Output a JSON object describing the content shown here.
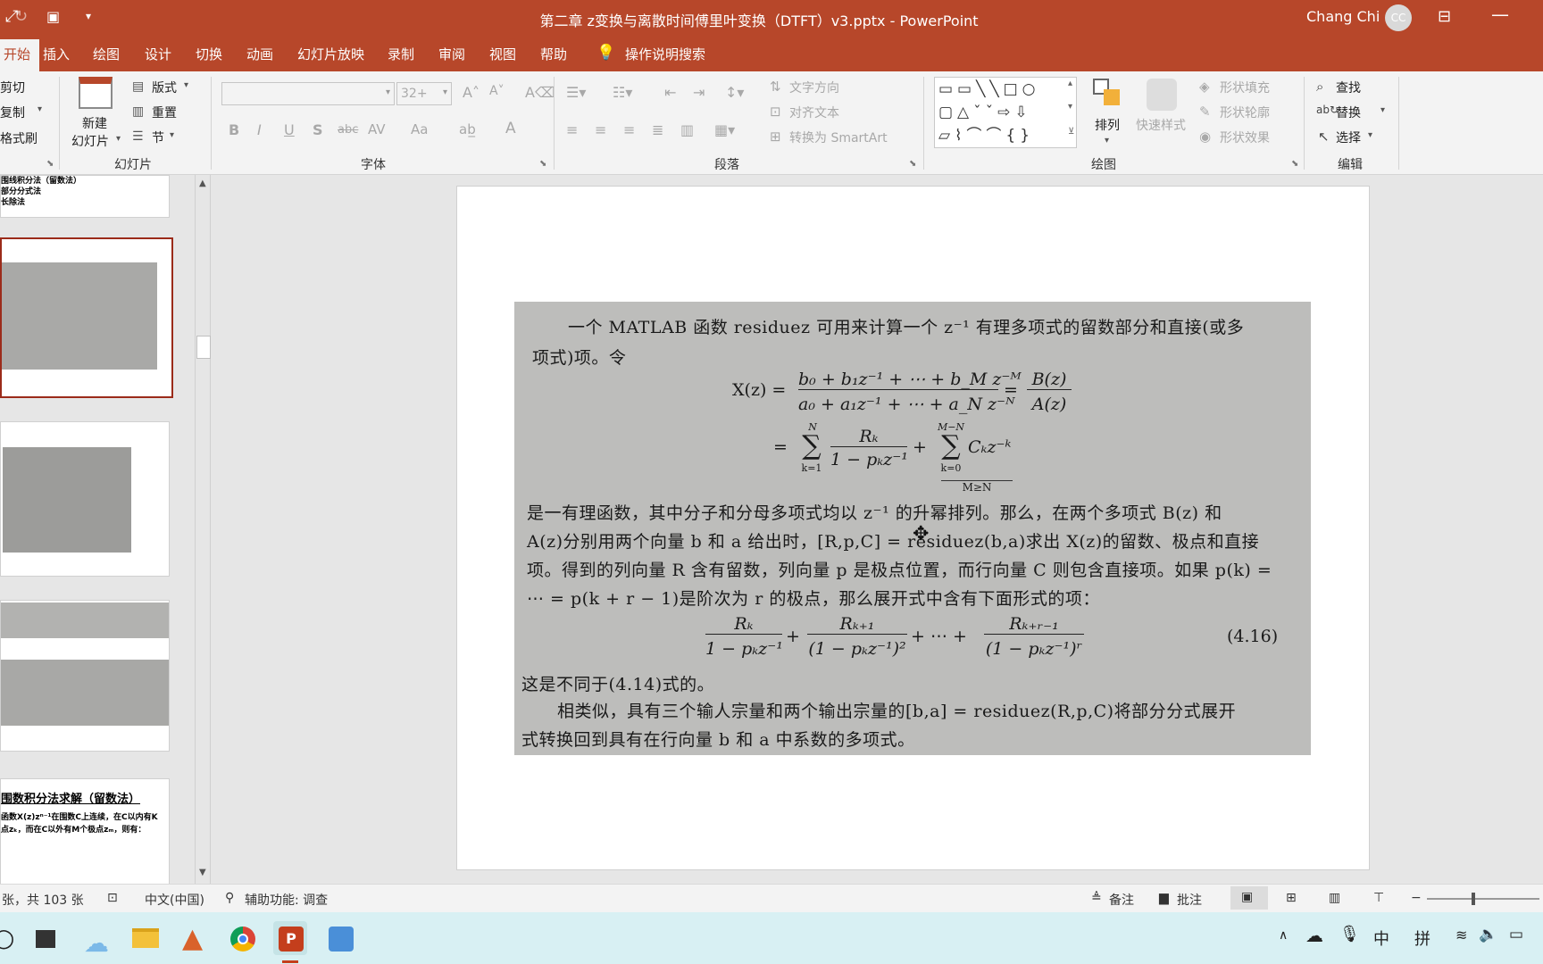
{
  "titlebar": {
    "title": "第二章 z变换与离散时间傅里叶变换（DTFT）v3.pptx  -  PowerPoint",
    "user": "Chang Chi",
    "initials": "CC",
    "window_controls": [
      "ribbon-display-icon",
      "minimize-icon"
    ]
  },
  "tabs": [
    "开始",
    "插入",
    "绘图",
    "设计",
    "切换",
    "动画",
    "幻灯片放映",
    "录制",
    "审阅",
    "视图",
    "帮助",
    "操作说明搜索"
  ],
  "ribbon": {
    "clipboard": {
      "cut": "剪切",
      "copy": "复制",
      "format_painter": "格式刷"
    },
    "slides": {
      "new_slide_line1": "新建",
      "new_slide_line2": "幻灯片",
      "layout": "版式",
      "reset": "重置",
      "section": "节",
      "label": "幻灯片"
    },
    "font": {
      "font_name": "",
      "font_size": "32+",
      "label": "字体",
      "bold": "B",
      "italic": "I",
      "underline": "U",
      "shadow": "S",
      "strike": "abc",
      "spacing": "AV",
      "case": "Aa",
      "color": "A"
    },
    "paragraph": {
      "text_direction": "文字方向",
      "align_text": "对齐文本",
      "smartart": "转换为 SmartArt",
      "label": "段落"
    },
    "drawing": {
      "arrange": "排列",
      "quick_styles": "快速样式",
      "shape_fill": "形状填充",
      "shape_outline": "形状轮廓",
      "shape_effects": "形状效果",
      "label": "绘图"
    },
    "editing": {
      "find": "查找",
      "replace": "替换",
      "select": "选择",
      "label": "编辑"
    }
  },
  "thumbnails": {
    "t1_lines": [
      "围线积分法（留数法）",
      "部分分式法",
      "长除法"
    ],
    "t5_title": "围数积分法求解（留数法）",
    "t5_lines": [
      "函数X(z)zⁿ⁻¹在围数C上连续，在C以内有K",
      "点zₖ，而在C以外有M个极点zₘ，则有："
    ]
  },
  "slide_text": {
    "para1_line1": "一个 MATLAB 函数 residuez 可用来计算一个 z⁻¹ 有理多项式的留数部分和直接(或多",
    "para1_line2": "项式)项。令",
    "eq1_lhs": "X(z) =",
    "eq1_num": "b₀ + b₁z⁻¹ + ⋯ + b_M z⁻ᴹ",
    "eq1_den": "a₀ + a₁z⁻¹ + ⋯ + a_N z⁻ᴺ",
    "eq1_eq": "=",
    "eq1_bz": "B(z)",
    "eq1_az": "A(z)",
    "eq2_eq": "=",
    "eq2_sum1_top": "N",
    "eq2_sum1_bot": "k=1",
    "eq2_rk": "Rₖ",
    "eq2_rk_den": "1 − pₖz⁻¹",
    "eq2_plus": "+",
    "eq2_sum2_top": "M−N",
    "eq2_sum2_bot": "k=0",
    "eq2_ck": "Cₖz⁻ᵏ",
    "eq2_cond": "M≥N",
    "para2_line1": "是一有理函数，其中分子和分母多项式均以 z⁻¹ 的升幂排列。那么，在两个多项式 B(z) 和",
    "para2_line2": "A(z)分别用两个向量 b 和 a 给出时，[R,p,C] = residuez(b,a)求出 X(z)的留数、极点和直接",
    "para2_line3": "项。得到的列向量 R 含有留数，列向量 p 是极点位置，而行向量 C 则包含直接项。如果 p(k) =",
    "para2_line4": "⋯ = p(k + r − 1)是阶次为 r 的极点，那么展开式中含有下面形式的项：",
    "eq3_t1_num": "Rₖ",
    "eq3_t1_den": "1 − pₖz⁻¹",
    "eq3_t2_num": "Rₖ₊₁",
    "eq3_t2_den": "(1 − pₖz⁻¹)²",
    "eq3_t3_num": "Rₖ₊ᵣ₋₁",
    "eq3_t3_den": "(1 − pₖz⁻¹)ʳ",
    "eq3_mid": "+ ⋯ +",
    "eq3_plus": "+",
    "eq3_tag": "(4.16)",
    "para3": "这是不同于(4.14)式的。",
    "para4_line1": "相类似，具有三个输人宗量和两个输出宗量的[b,a] = residuez(R,p,C)将部分分式展开",
    "para4_line2": "式转换回到具有在行向量 b 和 a 中系数的多项式。"
  },
  "statusbar": {
    "slide_count": "张，共 103 张",
    "language": "中文(中国)",
    "accessibility": "辅助功能: 调查",
    "notes": "备注",
    "comments": "批注"
  },
  "taskbar": {
    "ime_mode": "中",
    "ime_name": "拼"
  },
  "colors": {
    "accent": "#b7472a",
    "taskbar": "#d8f0f3",
    "scan_bg": "#bdbdbb"
  }
}
